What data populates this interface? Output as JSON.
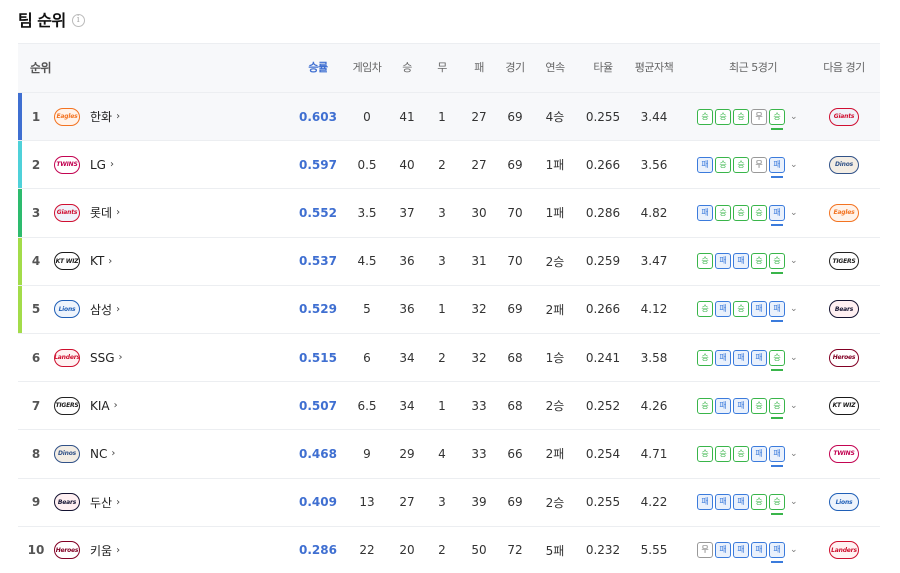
{
  "page": {
    "title": "팀 순위",
    "info_icon": "info-circle-icon"
  },
  "columns": {
    "rank": "순위",
    "pct": "승률",
    "gb": "게임차",
    "w": "승",
    "d": "무",
    "l": "패",
    "g": "경기",
    "streak": "연속",
    "avg": "타율",
    "era": "평균자책",
    "recent": "최근 5경기",
    "next": "다음 경기"
  },
  "team_styles": {
    "Eagles": {
      "color": "#f37321",
      "bg": "#fff3ea"
    },
    "TWINS": {
      "color": "#c30452",
      "bg": "#ffffff"
    },
    "Giants": {
      "color": "#d00f31",
      "bg": "#f0f3fa"
    },
    "KT WIZ": {
      "color": "#1a1a1a",
      "bg": "#ffffff"
    },
    "Lions": {
      "color": "#1f5fb7",
      "bg": "#eef4fc"
    },
    "Landers": {
      "color": "#ce0e2d",
      "bg": "#fff2f2"
    },
    "TIGERS": {
      "color": "#222222",
      "bg": "#ffffff"
    },
    "Dinos": {
      "color": "#315288",
      "bg": "#f3ede4"
    },
    "Bears": {
      "color": "#131230",
      "bg": "#fff0f2"
    },
    "Heroes": {
      "color": "#820024",
      "bg": "#ffffff"
    }
  },
  "rows": [
    {
      "rank": "1",
      "team": "한화",
      "logo": "Eagles",
      "pct": "0.603",
      "gb": "0",
      "w": "41",
      "d": "1",
      "l": "27",
      "g": "69",
      "streak": "4승",
      "avg": "0.255",
      "era": "3.44",
      "recent": [
        "승",
        "승",
        "승",
        "무",
        "승"
      ],
      "next": "Giants",
      "bar": "#3f6fd1"
    },
    {
      "rank": "2",
      "team": "LG",
      "logo": "TWINS",
      "pct": "0.597",
      "gb": "0.5",
      "w": "40",
      "d": "2",
      "l": "27",
      "g": "69",
      "streak": "1패",
      "avg": "0.266",
      "era": "3.56",
      "recent": [
        "패",
        "승",
        "승",
        "무",
        "패"
      ],
      "next": "Dinos",
      "bar": "#4fd1d9"
    },
    {
      "rank": "3",
      "team": "롯데",
      "logo": "Giants",
      "pct": "0.552",
      "gb": "3.5",
      "w": "37",
      "d": "3",
      "l": "30",
      "g": "70",
      "streak": "1패",
      "avg": "0.286",
      "era": "4.82",
      "recent": [
        "패",
        "승",
        "승",
        "승",
        "패"
      ],
      "next": "Eagles",
      "bar": "#2dbb6e"
    },
    {
      "rank": "4",
      "team": "KT",
      "logo": "KT WIZ",
      "pct": "0.537",
      "gb": "4.5",
      "w": "36",
      "d": "3",
      "l": "31",
      "g": "70",
      "streak": "2승",
      "avg": "0.259",
      "era": "3.47",
      "recent": [
        "승",
        "패",
        "패",
        "승",
        "승"
      ],
      "next": "TIGERS",
      "bar": "#a3dc4a"
    },
    {
      "rank": "5",
      "team": "삼성",
      "logo": "Lions",
      "pct": "0.529",
      "gb": "5",
      "w": "36",
      "d": "1",
      "l": "32",
      "g": "69",
      "streak": "2패",
      "avg": "0.266",
      "era": "4.12",
      "recent": [
        "승",
        "패",
        "승",
        "패",
        "패"
      ],
      "next": "Bears",
      "bar": "#a3dc4a"
    },
    {
      "rank": "6",
      "team": "SSG",
      "logo": "Landers",
      "pct": "0.515",
      "gb": "6",
      "w": "34",
      "d": "2",
      "l": "32",
      "g": "68",
      "streak": "1승",
      "avg": "0.241",
      "era": "3.58",
      "recent": [
        "승",
        "패",
        "패",
        "패",
        "승"
      ],
      "next": "Heroes",
      "bar": ""
    },
    {
      "rank": "7",
      "team": "KIA",
      "logo": "TIGERS",
      "pct": "0.507",
      "gb": "6.5",
      "w": "34",
      "d": "1",
      "l": "33",
      "g": "68",
      "streak": "2승",
      "avg": "0.252",
      "era": "4.26",
      "recent": [
        "승",
        "패",
        "패",
        "승",
        "승"
      ],
      "next": "KT WIZ",
      "bar": ""
    },
    {
      "rank": "8",
      "team": "NC",
      "logo": "Dinos",
      "pct": "0.468",
      "gb": "9",
      "w": "29",
      "d": "4",
      "l": "33",
      "g": "66",
      "streak": "2패",
      "avg": "0.254",
      "era": "4.71",
      "recent": [
        "승",
        "승",
        "승",
        "패",
        "패"
      ],
      "next": "TWINS",
      "bar": ""
    },
    {
      "rank": "9",
      "team": "두산",
      "logo": "Bears",
      "pct": "0.409",
      "gb": "13",
      "w": "27",
      "d": "3",
      "l": "39",
      "g": "69",
      "streak": "2승",
      "avg": "0.255",
      "era": "4.22",
      "recent": [
        "패",
        "패",
        "패",
        "승",
        "승"
      ],
      "next": "Lions",
      "bar": ""
    },
    {
      "rank": "10",
      "team": "키움",
      "logo": "Heroes",
      "pct": "0.286",
      "gb": "22",
      "w": "20",
      "d": "2",
      "l": "50",
      "g": "72",
      "streak": "5패",
      "avg": "0.232",
      "era": "5.55",
      "recent": [
        "무",
        "패",
        "패",
        "패",
        "패"
      ],
      "next": "Landers",
      "bar": ""
    }
  ]
}
